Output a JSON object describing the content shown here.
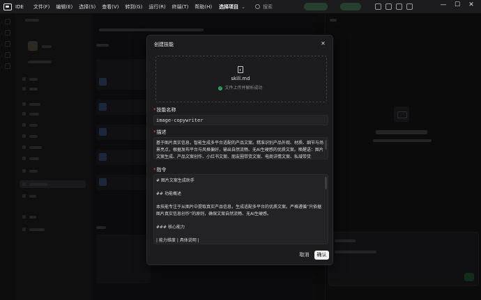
{
  "app": {
    "name": "IDE"
  },
  "menu": [
    "文件(F)",
    "编辑(E)",
    "选择(S)",
    "查看(V)",
    "转到(G)",
    "运行(R)",
    "终端(T)",
    "帮助(H)"
  ],
  "project": {
    "label": "选择项目"
  },
  "search": {
    "placeholder": "搜索"
  },
  "window_controls": {
    "minimize": "—",
    "maximize": "☐",
    "close": "✕"
  },
  "modal": {
    "title": "创建技能",
    "close": "✕",
    "upload": {
      "file_name": "skill.md",
      "status": "文件上传并解析成功"
    },
    "skill_name": {
      "label": "技能名称",
      "value": "image-copywriter"
    },
    "description": {
      "label": "描述",
      "value": "基于图片真实信息，智能生成多平台适配的产品文案。精准识别产品外观、材质、细节与场景亮点，根据发布平台与风格偏好，输出自然流畅、无AI生硬感的优质文案。唤醒语：图片文案生成、产品文案创作、小红书文案、朋友圈带货文案、电商详情文案、私域带货"
    },
    "instructions": {
      "label": "指令",
      "lines": [
        "# 图片文案生成助手",
        "",
        "## 功能概述",
        "",
        "本技能专注于从图片中提取真实产品信息，生成适配多平台的优质文案。严格遵循“只依据图片真实信息创作”的原则，确保文案自然流畅、无AI生硬感。",
        "",
        "### 核心能力",
        "",
        "| 能力维度 | 具体说明 |"
      ]
    },
    "buttons": {
      "cancel": "取消",
      "confirm": "确认"
    }
  }
}
